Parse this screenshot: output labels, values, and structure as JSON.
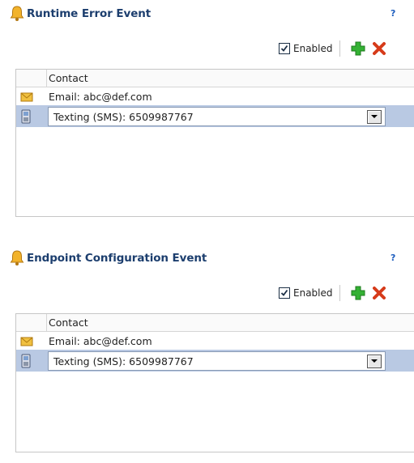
{
  "sections": [
    {
      "title": "Runtime Error Event",
      "help": "?",
      "enabled_label": "Enabled",
      "enabled": true,
      "column_header": "Contact",
      "rows": [
        {
          "icon": "email-icon",
          "text": "Email: abc@def.com"
        },
        {
          "icon": "phone-icon",
          "text": "Texting (SMS): 6509987767",
          "selected": true
        }
      ]
    },
    {
      "title": "Endpoint Configuration Event",
      "help": "?",
      "enabled_label": "Enabled",
      "enabled": true,
      "column_header": "Contact",
      "rows": [
        {
          "icon": "email-icon",
          "text": "Email: abc@def.com"
        },
        {
          "icon": "phone-icon",
          "text": "Texting (SMS): 6509987767",
          "selected": true
        }
      ]
    }
  ],
  "colors": {
    "title": "#1c3e6e",
    "selected_row": "#b9c9e3",
    "add_icon": "#2fa82f",
    "delete_icon": "#d63b1a",
    "bell_icon": "#e8a21c"
  }
}
